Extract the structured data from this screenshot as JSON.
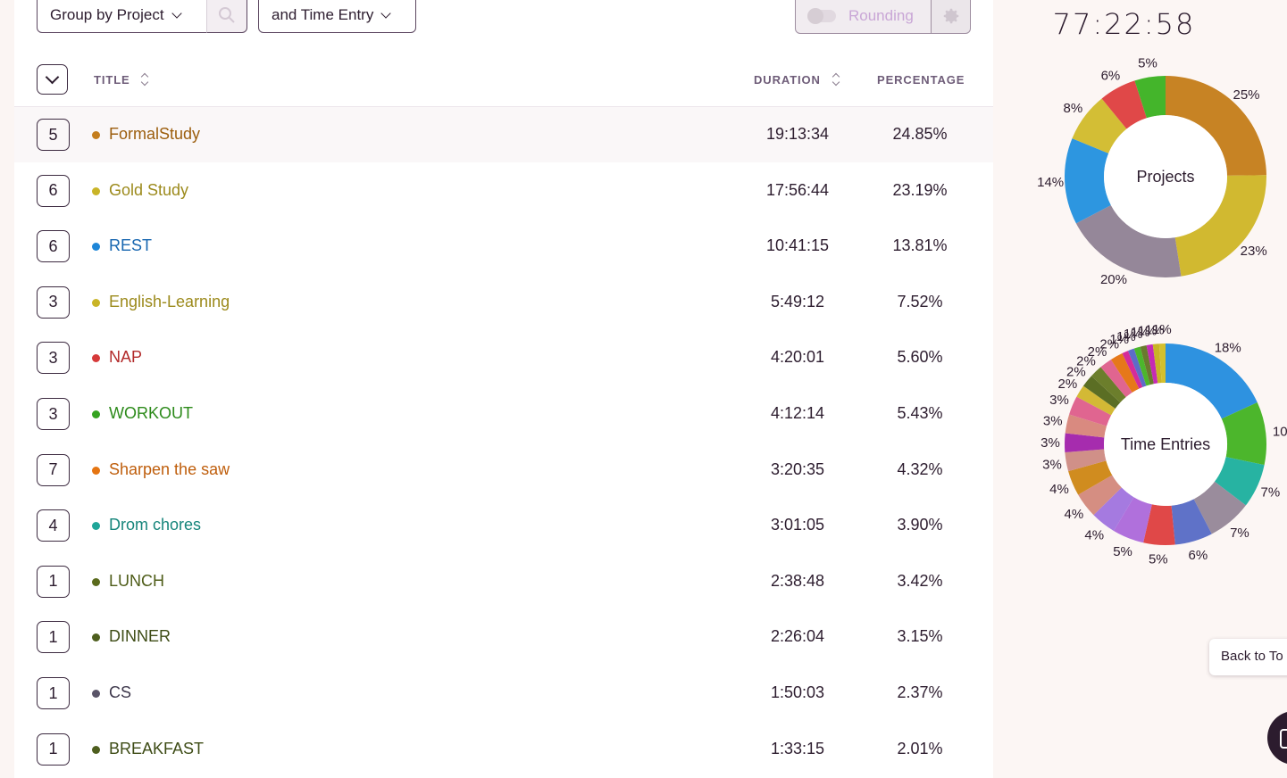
{
  "toolbar": {
    "group_by_label": "Group by Project",
    "secondary_group_label": "and Time Entry",
    "rounding_label": "Rounding"
  },
  "table": {
    "headers": {
      "title": "TITLE",
      "duration": "DURATION",
      "percentage": "PERCENTAGE"
    },
    "rows": [
      {
        "count": "5",
        "title": "FormalStudy",
        "duration": "19:13:34",
        "percentage": "24.85%",
        "color": "#c47d1d",
        "text_color": "#9c5e0e"
      },
      {
        "count": "6",
        "title": "Gold Study",
        "duration": "17:56:44",
        "percentage": "23.19%",
        "color": "#c9b427",
        "text_color": "#9c8a1c"
      },
      {
        "count": "6",
        "title": "REST",
        "duration": "10:41:15",
        "percentage": "13.81%",
        "color": "#1e86d8",
        "text_color": "#1766b0"
      },
      {
        "count": "3",
        "title": "English-Learning",
        "duration": "5:49:12",
        "percentage": "7.52%",
        "color": "#c9b427",
        "text_color": "#9c8a1c"
      },
      {
        "count": "3",
        "title": "NAP",
        "duration": "4:20:01",
        "percentage": "5.60%",
        "color": "#d63a3a",
        "text_color": "#b22a2a"
      },
      {
        "count": "3",
        "title": "WORKOUT",
        "duration": "4:12:14",
        "percentage": "5.43%",
        "color": "#35a320",
        "text_color": "#2c8a1a"
      },
      {
        "count": "7",
        "title": "Sharpen the saw",
        "duration": "3:20:35",
        "percentage": "4.32%",
        "color": "#e57512",
        "text_color": "#bf5e0c"
      },
      {
        "count": "4",
        "title": "Drom chores",
        "duration": "3:01:05",
        "percentage": "3.90%",
        "color": "#1fa699",
        "text_color": "#16857b"
      },
      {
        "count": "1",
        "title": "LUNCH",
        "duration": "2:38:48",
        "percentage": "3.42%",
        "color": "#5b6b1d",
        "text_color": "#4e5c18"
      },
      {
        "count": "1",
        "title": "DINNER",
        "duration": "2:26:04",
        "percentage": "3.15%",
        "color": "#4e5e1e",
        "text_color": "#3e4c16"
      },
      {
        "count": "1",
        "title": "CS",
        "duration": "1:50:03",
        "percentage": "2.37%",
        "color": "#5a5468",
        "text_color": "#3e384c"
      },
      {
        "count": "1",
        "title": "BREAKFAST",
        "duration": "1:33:15",
        "percentage": "2.01%",
        "color": "#4e5e1e",
        "text_color": "#3e4c16"
      }
    ]
  },
  "summary": {
    "total_time": "77:22:58",
    "back_to_top_label": "Back to To"
  },
  "chart_data": [
    {
      "type": "pie",
      "title": "Projects",
      "categories": [
        "FormalStudy",
        "Gold Study",
        "REST",
        "English-Learning",
        "NAP",
        "WORKOUT"
      ],
      "slices": [
        {
          "label": "25%",
          "value": 25,
          "color": "#c78324"
        },
        {
          "label": "23%",
          "value": 23,
          "color": "#d1b930"
        },
        {
          "label": "20%",
          "value": 20,
          "color": "#958799"
        },
        {
          "label": "14%",
          "value": 14,
          "color": "#2d96e0"
        },
        {
          "label": "8%",
          "value": 8,
          "color": "#d3be35"
        },
        {
          "label": "6%",
          "value": 6,
          "color": "#e04848"
        },
        {
          "label": "5%",
          "value": 5,
          "color": "#44b52b"
        }
      ]
    },
    {
      "type": "pie",
      "title": "Time Entries",
      "slices": [
        {
          "label": "18%",
          "value": 18,
          "color": "#2e92e0"
        },
        {
          "label": "10",
          "value": 10,
          "color": "#4cb62c"
        },
        {
          "label": "7%",
          "value": 7,
          "color": "#27b3a2"
        },
        {
          "label": "7%",
          "value": 7,
          "color": "#9a8c9c"
        },
        {
          "label": "6%",
          "value": 6,
          "color": "#5f72c8"
        },
        {
          "label": "5%",
          "value": 5,
          "color": "#e04848"
        },
        {
          "label": "5%",
          "value": 5,
          "color": "#b070dc"
        },
        {
          "label": "4%",
          "value": 4,
          "color": "#a57ae0"
        },
        {
          "label": "4%",
          "value": 4,
          "color": "#d58e82"
        },
        {
          "label": "4%",
          "value": 4,
          "color": "#d08c1f"
        },
        {
          "label": "3%",
          "value": 3,
          "color": "#d09088"
        },
        {
          "label": "3%",
          "value": 3,
          "color": "#a62cae"
        },
        {
          "label": "3%",
          "value": 3,
          "color": "#d98a80"
        },
        {
          "label": "3%",
          "value": 3,
          "color": "#e06590"
        },
        {
          "label": "2%",
          "value": 2,
          "color": "#d3b935"
        },
        {
          "label": "2%",
          "value": 2,
          "color": "#5b6e24"
        },
        {
          "label": "2%",
          "value": 2,
          "color": "#6c7e2c"
        },
        {
          "label": "2%",
          "value": 2,
          "color": "#e06590"
        },
        {
          "label": "2%",
          "value": 2,
          "color": "#e6781a"
        },
        {
          "label": "1%",
          "value": 1,
          "color": "#d42c9a"
        },
        {
          "label": "1%",
          "value": 1,
          "color": "#5d6cc8"
        },
        {
          "label": "1%",
          "value": 1,
          "color": "#4cb62c"
        },
        {
          "label": "1%",
          "value": 1,
          "color": "#6a7a2e"
        },
        {
          "label": "1%",
          "value": 1,
          "color": "#c62ab6"
        },
        {
          "label": "1%",
          "value": 1,
          "color": "#c9b427"
        },
        {
          "label": "1%",
          "value": 1,
          "color": "#d4c02e"
        }
      ]
    }
  ]
}
